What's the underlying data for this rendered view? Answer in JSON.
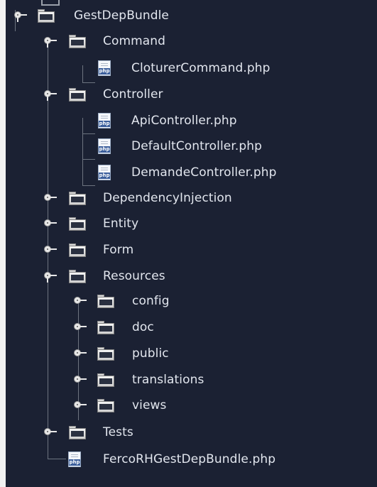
{
  "tree": {
    "nodes": [
      {
        "label": "GestDepBundle",
        "type": "folder",
        "expanded": true,
        "icon": "folder-icon"
      },
      {
        "label": "Command",
        "type": "folder",
        "expanded": true,
        "icon": "folder-icon"
      },
      {
        "label": "CloturerCommand.php",
        "type": "file",
        "icon": "php-file-icon",
        "badge": "php"
      },
      {
        "label": "Controller",
        "type": "folder",
        "expanded": true,
        "icon": "folder-icon"
      },
      {
        "label": "ApiController.php",
        "type": "file",
        "icon": "php-file-icon",
        "badge": "php"
      },
      {
        "label": "DefaultController.php",
        "type": "file",
        "icon": "php-file-icon",
        "badge": "php"
      },
      {
        "label": "DemandeController.php",
        "type": "file",
        "icon": "php-file-icon",
        "badge": "php"
      },
      {
        "label": "DependencyInjection",
        "type": "folder",
        "expanded": false,
        "icon": "folder-icon"
      },
      {
        "label": "Entity",
        "type": "folder",
        "expanded": false,
        "icon": "folder-icon"
      },
      {
        "label": "Form",
        "type": "folder",
        "expanded": false,
        "icon": "folder-icon"
      },
      {
        "label": "Resources",
        "type": "folder",
        "expanded": true,
        "icon": "folder-icon"
      },
      {
        "label": "config",
        "type": "folder",
        "expanded": false,
        "icon": "folder-icon"
      },
      {
        "label": "doc",
        "type": "folder",
        "expanded": false,
        "icon": "folder-icon"
      },
      {
        "label": "public",
        "type": "folder",
        "expanded": false,
        "icon": "folder-icon"
      },
      {
        "label": "translations",
        "type": "folder",
        "expanded": false,
        "icon": "folder-icon"
      },
      {
        "label": "views",
        "type": "folder",
        "expanded": false,
        "icon": "folder-icon"
      },
      {
        "label": "Tests",
        "type": "folder",
        "expanded": false,
        "icon": "folder-icon"
      },
      {
        "label": "FercoRHGestDepBundle.php",
        "type": "file",
        "icon": "php-file-icon",
        "badge": "php"
      }
    ]
  },
  "colors": {
    "background": "#1b2133",
    "text": "#e2e6ee",
    "tree_lines": "#6d7480",
    "php_badge": "#3c5f9c"
  }
}
